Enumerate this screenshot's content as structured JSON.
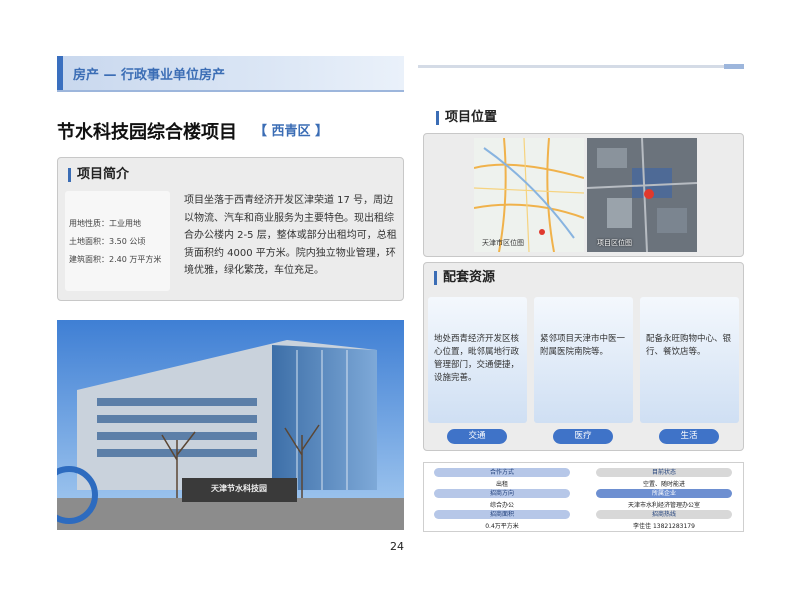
{
  "header": {
    "category": "房产 — 行政事业单位房产"
  },
  "project": {
    "title": "节水科技园综合楼项目",
    "district": "【 西青区 】"
  },
  "intro": {
    "heading": "项目简介",
    "facts": [
      "用地性质：工业用地",
      "土地面积：3.50 公顷",
      "建筑面积：2.40 万平方米"
    ],
    "text": "项目坐落于西青经济开发区津荣道 17 号，周边以物流、汽车和商业服务为主要特色。现出租综合办公楼内 2-5 层，整体或部分出租均可，总租赁面积约 4000 平方米。院内独立物业管理，环境优雅，绿化繁茂，车位充足。"
  },
  "photo": {
    "sign_text": "天津节水科技园"
  },
  "location": {
    "heading": "项目位置",
    "map1_caption": "天津市区位图",
    "map2_caption": "项目区位图"
  },
  "resources": {
    "heading": "配套资源",
    "cards": [
      {
        "text": "地处西青经济开发区核心位置，毗邻属地行政管理部门，交通便捷，设施完善。",
        "label": "交通"
      },
      {
        "text": "紧邻项目天津市中医一附属医院南院等。",
        "label": "医疗"
      },
      {
        "text": "配备永旺购物中心、银行、餐饮店等。",
        "label": "生活"
      }
    ]
  },
  "info": {
    "coop_label": "合作方式",
    "coop_value": "出租",
    "status_label": "目前状态",
    "status_value": "空置、随时能进",
    "direction_label": "招商方向",
    "direction_value": "综合办公",
    "owner_label": "所属企业",
    "owner_value": "天津市水利经济管理办公室",
    "area_label": "招商面积",
    "area_value": "0.4万平方米",
    "hotline_label": "招商热线",
    "hotline_value": "李佳佳 13821283179"
  },
  "page_number": "24",
  "colors": {
    "accent": "#3b6db5",
    "pill": "#3f73c8",
    "panel": "#ececec"
  }
}
